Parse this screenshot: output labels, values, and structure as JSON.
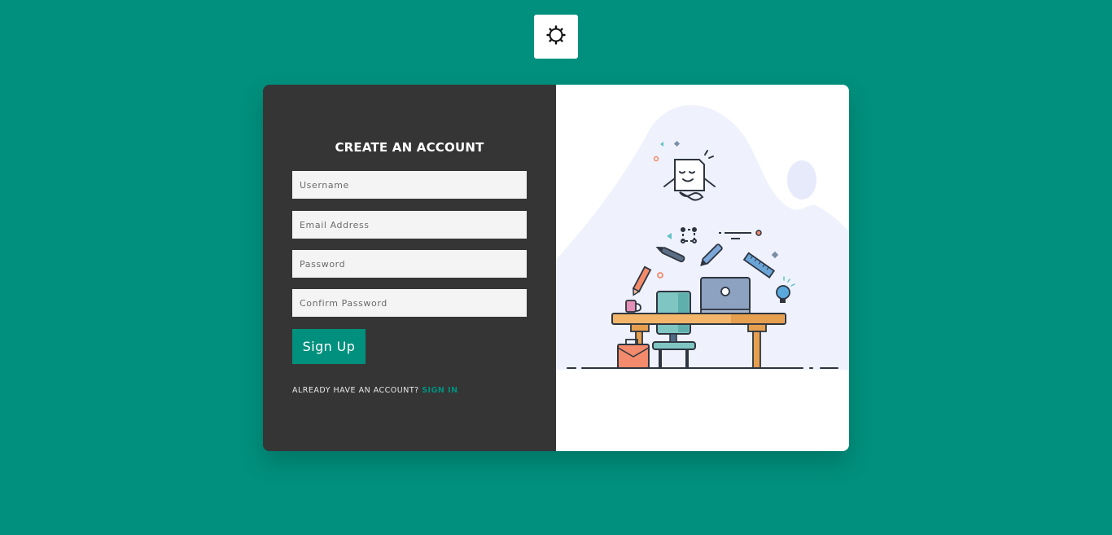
{
  "theme_toggle": {
    "icon": "sun-icon"
  },
  "form": {
    "title": "CREATE AN ACCOUNT",
    "username_placeholder": "Username",
    "email_placeholder": "Email Address",
    "password_placeholder": "Password",
    "confirm_password_placeholder": "Confirm Password",
    "submit_label": "Sign Up",
    "already_text": "ALREADY HAVE AN ACCOUNT?",
    "signin_link": "SIGN IN"
  },
  "colors": {
    "page_background": "#01907d",
    "panel_background": "#353535",
    "accent": "#01907d",
    "input_background": "#f4f4f4"
  }
}
